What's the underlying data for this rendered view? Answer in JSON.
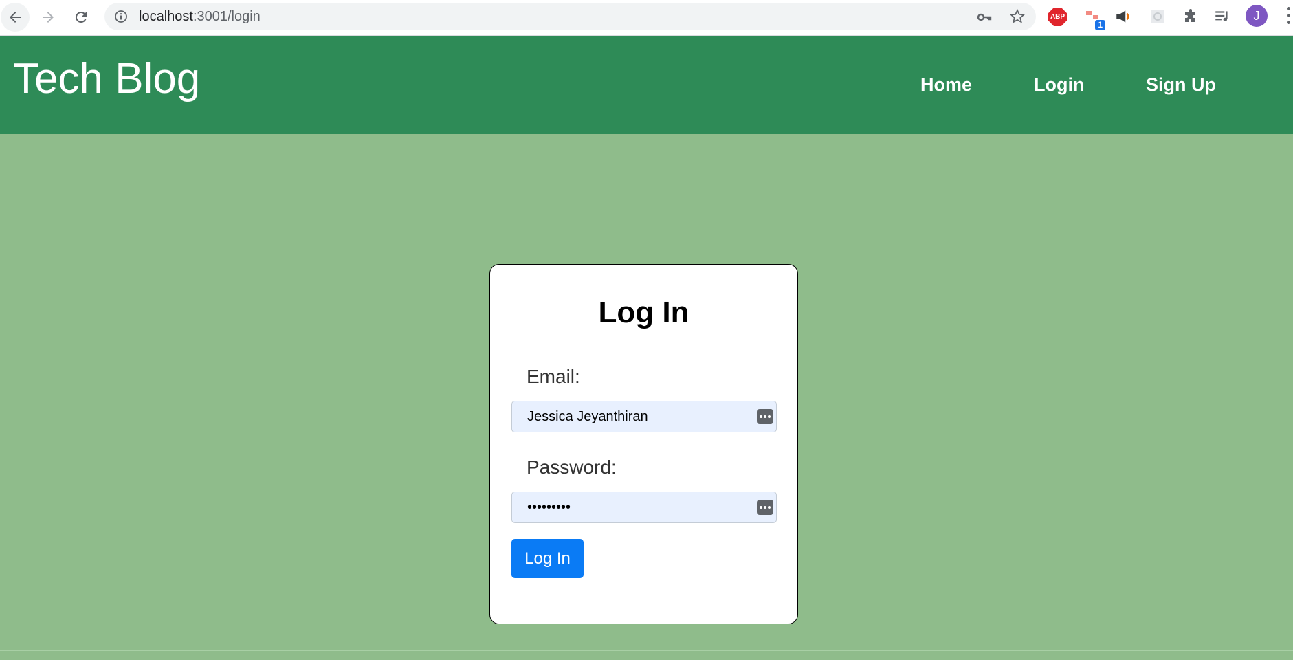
{
  "browser": {
    "url_host": "localhost",
    "url_path": ":3001/login",
    "extensions": {
      "abp_label": "ABP",
      "badge_count": "1",
      "profile_initial": "J"
    }
  },
  "header": {
    "title": "Tech Blog",
    "nav": [
      {
        "label": "Home"
      },
      {
        "label": "Login"
      },
      {
        "label": "Sign Up"
      }
    ]
  },
  "login": {
    "title": "Log In",
    "email_label": "Email:",
    "email_value": "Jessica Jeyanthiran",
    "password_label": "Password:",
    "password_value": "secret123",
    "submit_label": "Log In"
  },
  "colors": {
    "header_bg": "#2e8b57",
    "page_bg": "#8fbc8b",
    "button_bg": "#0a7bf5",
    "autofill_bg": "#e8f0fe"
  }
}
